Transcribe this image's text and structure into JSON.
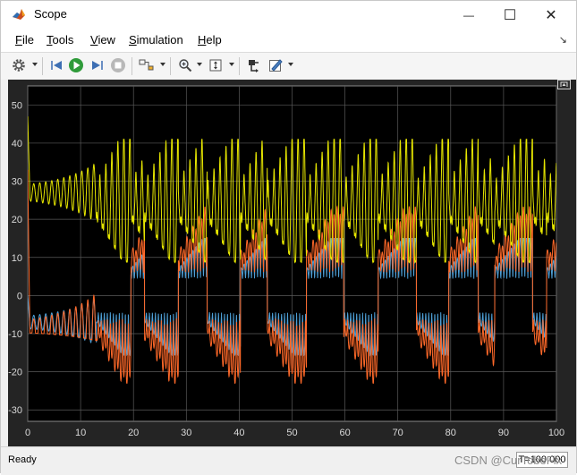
{
  "window": {
    "title": "Scope"
  },
  "window_controls": {
    "minimize": "—",
    "maximize": "☐",
    "close": "✕"
  },
  "menubar": {
    "items": [
      {
        "first": "F",
        "rest": "ile"
      },
      {
        "first": "T",
        "rest": "ools"
      },
      {
        "first": "V",
        "rest": "iew"
      },
      {
        "first": "S",
        "rest": "imulation"
      },
      {
        "first": "H",
        "rest": "elp"
      }
    ],
    "dock_arrow": "↘"
  },
  "toolbar": {
    "icons": [
      "gear-icon",
      "step-back-icon",
      "run-icon",
      "step-forward-icon",
      "stop-icon",
      "signal-select-icon",
      "zoom-icon",
      "autoscale-icon",
      "highlight-icon",
      "style-icon"
    ]
  },
  "chart_data": {
    "type": "line",
    "title": "",
    "xlabel": "",
    "ylabel": "",
    "xlim": [
      0,
      100
    ],
    "ylim": [
      -33,
      55
    ],
    "x_ticks": [
      0,
      10,
      20,
      30,
      40,
      50,
      60,
      70,
      80,
      90,
      100
    ],
    "y_ticks": [
      -30,
      -20,
      -10,
      0,
      10,
      20,
      30,
      40,
      50
    ],
    "grid": true,
    "background": "#000000",
    "series": [
      {
        "color": "#e6e600",
        "values_summary": {
          "start": 47,
          "initial_band": [
            25,
            30
          ],
          "oscillation_band": [
            8,
            41
          ]
        }
      },
      {
        "color": "#ff6929",
        "values_summary": {
          "start": 33,
          "initial_band": [
            -10,
            -8
          ],
          "oscillation_band": [
            -23,
            29
          ]
        }
      },
      {
        "color": "#4d9fd6",
        "values_summary": {
          "start": 0,
          "initial_band": [
            -8,
            -6
          ],
          "oscillation_band": [
            -20,
            15
          ]
        }
      }
    ]
  },
  "statusbar": {
    "ready": "Ready",
    "time": "T=100.000"
  },
  "watermark": "CSDN @CurTobeFix"
}
